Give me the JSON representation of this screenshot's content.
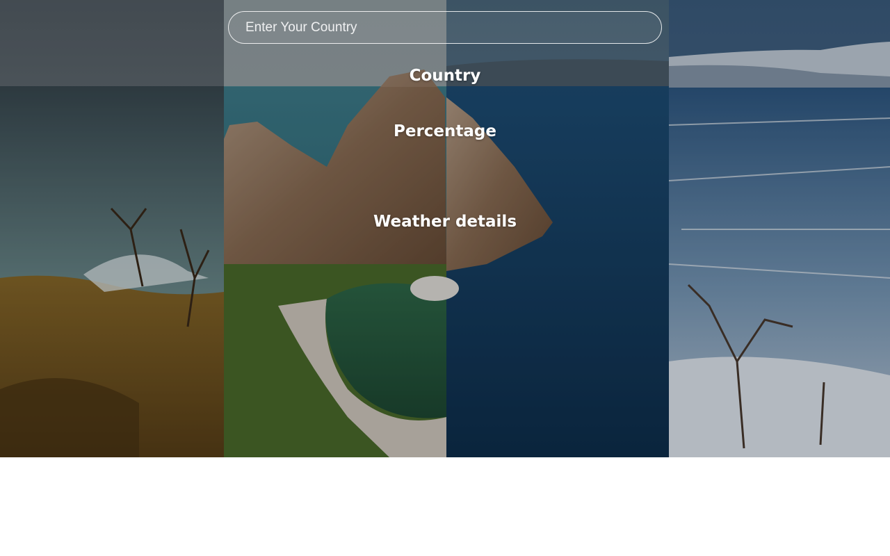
{
  "search": {
    "placeholder": "Enter Your Country",
    "value": ""
  },
  "result": {
    "country_label": "Country",
    "percentage_label": "Percentage",
    "weather_label": "Weather details"
  },
  "background": {
    "panels": [
      "autumn-shore",
      "summer-rock",
      "deep-lake",
      "winter-ice"
    ]
  }
}
